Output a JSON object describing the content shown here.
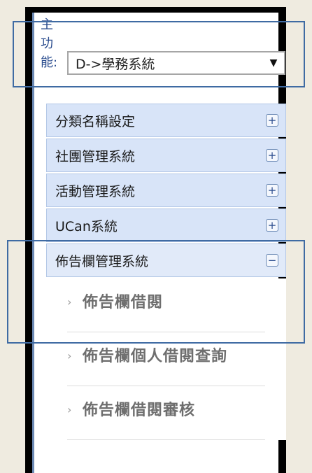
{
  "selector": {
    "label": "主功能:",
    "value": "D->學務系統",
    "arrow": "▼"
  },
  "menu": {
    "items": [
      {
        "label": "分類名稱設定",
        "toggle": "+"
      },
      {
        "label": "社團管理系統",
        "toggle": "+"
      },
      {
        "label": "活動管理系統",
        "toggle": "+"
      },
      {
        "label": "UCan系統",
        "toggle": "+"
      },
      {
        "label": "佈告欄管理系統",
        "toggle": "−"
      }
    ],
    "subitems": [
      {
        "label": "佈告欄借閱",
        "arrow": "›"
      },
      {
        "label": "佈告欄個人借閱查詢",
        "arrow": "›"
      },
      {
        "label": "佈告欄借閱審核",
        "arrow": "›"
      }
    ]
  },
  "colors": {
    "background": "#efebe0",
    "menu_header": "#d8e4f8",
    "highlight_border": "#3f6ba3",
    "link_text": "#2a4c8e"
  }
}
